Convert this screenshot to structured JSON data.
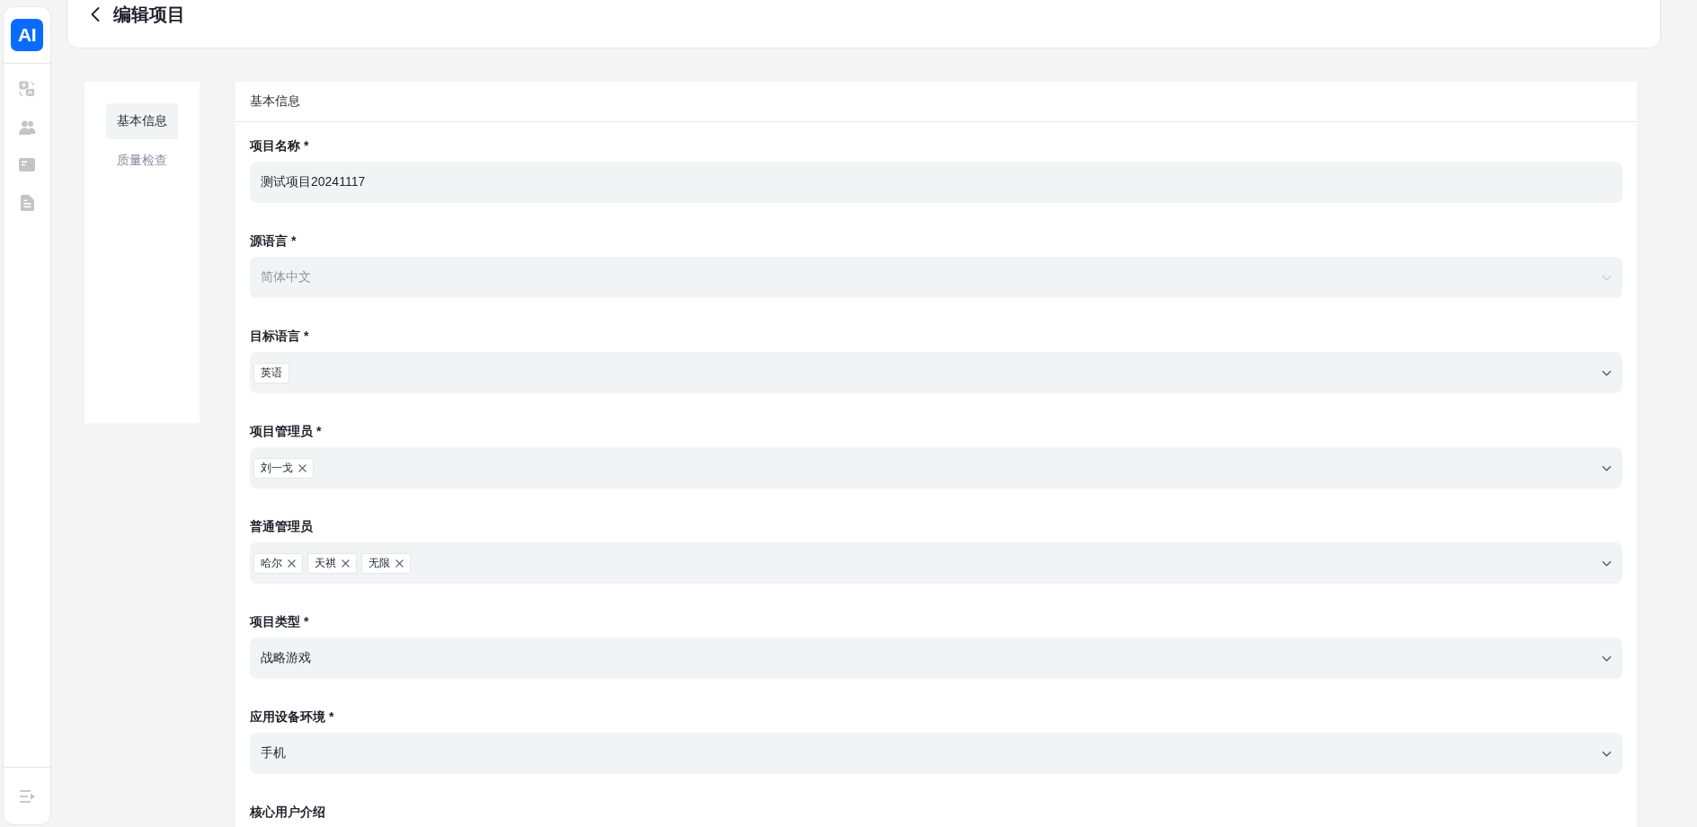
{
  "rail": {
    "logo": "AI"
  },
  "header": {
    "title": "编辑项目"
  },
  "section_nav": {
    "items": [
      {
        "label": "基本信息",
        "selected": true
      },
      {
        "label": "质量检查",
        "selected": false
      }
    ]
  },
  "form": {
    "title": "基本信息",
    "fields": [
      {
        "label": "项目名称 *",
        "kind": "text",
        "value": "测试项目20241117",
        "disabled": false
      },
      {
        "label": "源语言 *",
        "kind": "select",
        "value": "简体中文",
        "disabled": true
      },
      {
        "label": "目标语言 *",
        "kind": "multiselect",
        "disabled": false,
        "tags": [
          {
            "text": "英语",
            "removable": false
          }
        ]
      },
      {
        "label": "项目管理员 *",
        "kind": "multiselect",
        "disabled": false,
        "tags": [
          {
            "text": "刘一戈",
            "removable": true
          }
        ]
      },
      {
        "label": "普通管理员",
        "kind": "multiselect",
        "disabled": false,
        "tags": [
          {
            "text": "哈尔",
            "removable": true
          },
          {
            "text": "天祺",
            "removable": true
          },
          {
            "text": "无限",
            "removable": true
          }
        ]
      },
      {
        "label": "项目类型 *",
        "kind": "select",
        "value": "战略游戏",
        "disabled": false
      },
      {
        "label": "应用设备环境 *",
        "kind": "select",
        "value": "手机",
        "disabled": false
      },
      {
        "label": "核心用户介绍",
        "kind": "label_only"
      }
    ]
  }
}
